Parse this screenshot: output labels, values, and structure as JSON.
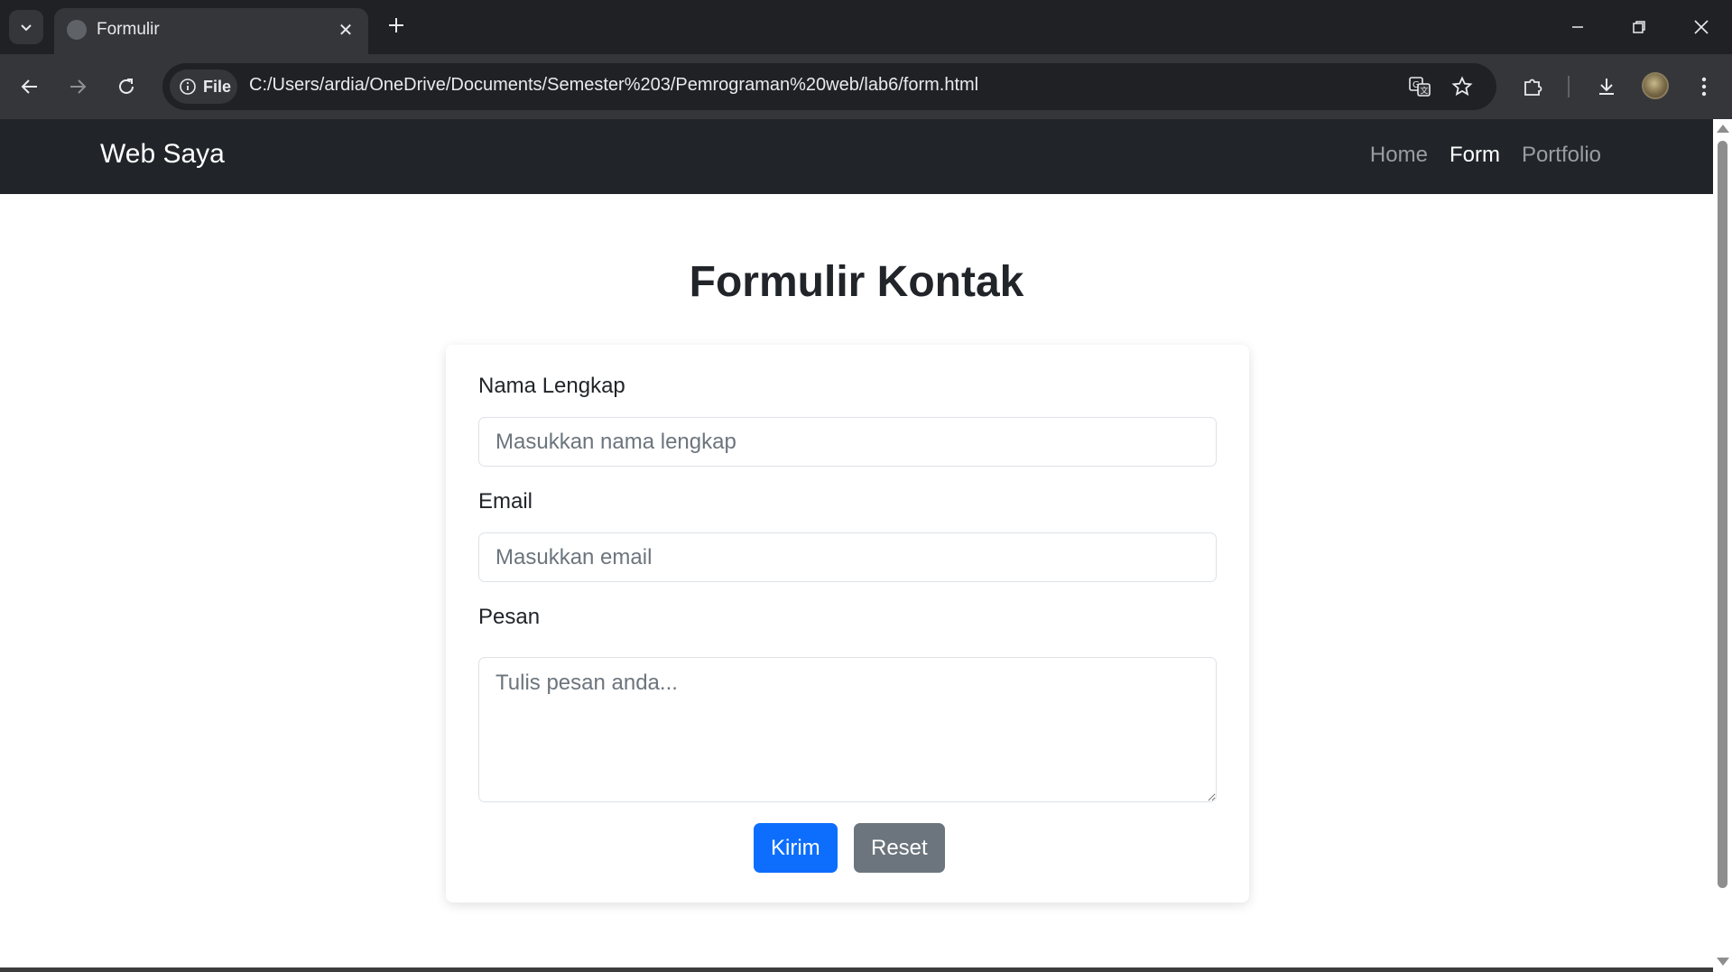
{
  "browser": {
    "tab_title": "Formulir",
    "site_info_label": "File",
    "url": "C:/Users/ardia/OneDrive/Documents/Semester%203/Pemrograman%20web/lab6/form.html"
  },
  "navbar": {
    "brand": "Web Saya",
    "links": [
      {
        "label": "Home",
        "active": false
      },
      {
        "label": "Form",
        "active": true
      },
      {
        "label": "Portfolio",
        "active": false
      }
    ]
  },
  "page": {
    "title": "Formulir Kontak"
  },
  "form": {
    "name_label": "Nama Lengkap",
    "name_placeholder": "Masukkan nama lengkap",
    "name_value": "",
    "email_label": "Email",
    "email_placeholder": "Masukkan email",
    "email_value": "",
    "message_label": "Pesan",
    "message_placeholder": "Tulis pesan anda...",
    "message_value": "",
    "submit_label": "Kirim",
    "reset_label": "Reset"
  },
  "colors": {
    "navbar_bg": "#212529",
    "primary": "#0d6efd",
    "secondary": "#6c757d"
  }
}
